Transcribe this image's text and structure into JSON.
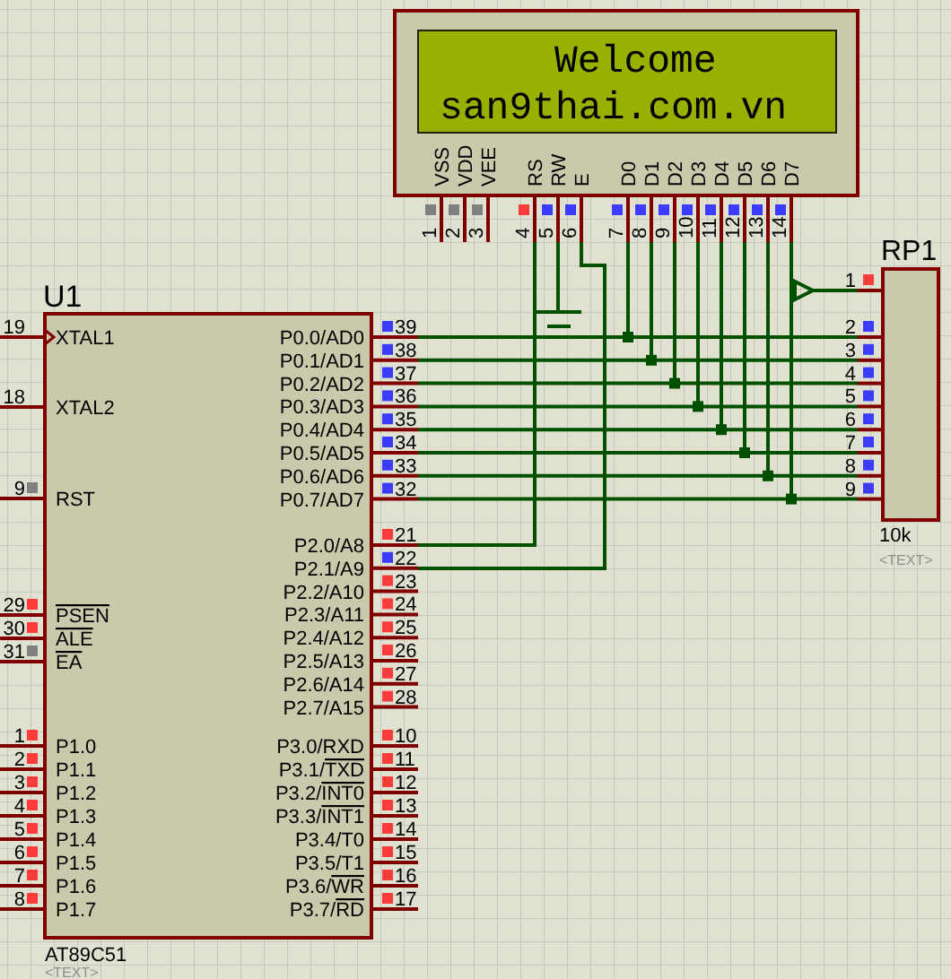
{
  "lcd": {
    "lines": [
      "Welcome",
      "san9thai.com.vn"
    ],
    "pins": [
      {
        "number": "1",
        "name": "VSS",
        "color": "#808080"
      },
      {
        "number": "2",
        "name": "VDD",
        "color": "#808080"
      },
      {
        "number": "3",
        "name": "VEE",
        "color": "#808080"
      },
      {
        "number": "4",
        "name": "RS",
        "color": "#ff3c3c"
      },
      {
        "number": "5",
        "name": "RW",
        "color": "#3c3cff"
      },
      {
        "number": "6",
        "name": "E",
        "color": "#3c3cff"
      },
      {
        "number": "7",
        "name": "D0",
        "color": "#3c3cff"
      },
      {
        "number": "8",
        "name": "D1",
        "color": "#3c3cff"
      },
      {
        "number": "9",
        "name": "D2",
        "color": "#3c3cff"
      },
      {
        "number": "10",
        "name": "D3",
        "color": "#3c3cff"
      },
      {
        "number": "11",
        "name": "D4",
        "color": "#3c3cff"
      },
      {
        "number": "12",
        "name": "D5",
        "color": "#3c3cff"
      },
      {
        "number": "13",
        "name": "D6",
        "color": "#3c3cff"
      },
      {
        "number": "14",
        "name": "D7",
        "color": "#3c3cff"
      }
    ]
  },
  "u1": {
    "reference": "U1",
    "part": "AT89C51",
    "text_label": "<TEXT>",
    "left_pins": [
      {
        "number": "19",
        "name": "XTAL1"
      },
      {
        "number": "18",
        "name": "XTAL2"
      },
      {
        "number": "9",
        "name": "RST",
        "color": "#808080"
      },
      {
        "number": "29",
        "name_barred": "PSEN",
        "color": "#ff3c3c"
      },
      {
        "number": "30",
        "name_barred": "ALE",
        "color": "#ff3c3c"
      },
      {
        "number": "31",
        "name_barred": "EA",
        "color": "#808080"
      },
      {
        "number": "1",
        "name": "P1.0",
        "color": "#ff3c3c"
      },
      {
        "number": "2",
        "name": "P1.1",
        "color": "#ff3c3c"
      },
      {
        "number": "3",
        "name": "P1.2",
        "color": "#ff3c3c"
      },
      {
        "number": "4",
        "name": "P1.3",
        "color": "#ff3c3c"
      },
      {
        "number": "5",
        "name": "P1.4",
        "color": "#ff3c3c"
      },
      {
        "number": "6",
        "name": "P1.5",
        "color": "#ff3c3c"
      },
      {
        "number": "7",
        "name": "P1.6",
        "color": "#ff3c3c"
      },
      {
        "number": "8",
        "name": "P1.7",
        "color": "#ff3c3c"
      }
    ],
    "right_pins": [
      {
        "number": "39",
        "name": "P0.0/AD0",
        "color": "#3c3cff"
      },
      {
        "number": "38",
        "name": "P0.1/AD1",
        "color": "#3c3cff"
      },
      {
        "number": "37",
        "name": "P0.2/AD2",
        "color": "#3c3cff"
      },
      {
        "number": "36",
        "name": "P0.3/AD3",
        "color": "#3c3cff"
      },
      {
        "number": "35",
        "name": "P0.4/AD4",
        "color": "#3c3cff"
      },
      {
        "number": "34",
        "name": "P0.5/AD5",
        "color": "#3c3cff"
      },
      {
        "number": "33",
        "name": "P0.6/AD6",
        "color": "#3c3cff"
      },
      {
        "number": "32",
        "name": "P0.7/AD7",
        "color": "#3c3cff"
      },
      {
        "number": "21",
        "name": "P2.0/A8",
        "color": "#ff3c3c"
      },
      {
        "number": "22",
        "name": "P2.1/A9",
        "color": "#3c3cff"
      },
      {
        "number": "23",
        "name": "P2.2/A10",
        "color": "#ff3c3c"
      },
      {
        "number": "24",
        "name": "P2.3/A11",
        "color": "#ff3c3c"
      },
      {
        "number": "25",
        "name": "P2.4/A12",
        "color": "#ff3c3c"
      },
      {
        "number": "26",
        "name": "P2.5/A13",
        "color": "#ff3c3c"
      },
      {
        "number": "27",
        "name": "P2.6/A14",
        "color": "#ff3c3c"
      },
      {
        "number": "28",
        "name": "P2.7/A15",
        "color": "#ff3c3c"
      },
      {
        "number": "10",
        "name": "P3.0/RXD",
        "color": "#ff3c3c"
      },
      {
        "number": "11",
        "name": "P3.1/",
        "name_barred": "TXD",
        "color": "#ff3c3c"
      },
      {
        "number": "12",
        "name": "P3.2/",
        "name_barred": "INT0",
        "color": "#ff3c3c"
      },
      {
        "number": "13",
        "name": "P3.3/",
        "name_barred": "INT1",
        "color": "#ff3c3c"
      },
      {
        "number": "14",
        "name": "P3.4/T0",
        "color": "#ff3c3c"
      },
      {
        "number": "15",
        "name": "P3.5/T1",
        "color": "#ff3c3c"
      },
      {
        "number": "16",
        "name": "P3.6/",
        "name_barred": "WR",
        "color": "#ff3c3c"
      },
      {
        "number": "17",
        "name": "P3.7/",
        "name_barred": "RD",
        "color": "#ff3c3c"
      }
    ]
  },
  "rp1": {
    "reference": "RP1",
    "value": "10k",
    "text_label": "<TEXT>",
    "pins": [
      {
        "number": "1",
        "color": "#ff3c3c"
      },
      {
        "number": "2",
        "color": "#3c3cff"
      },
      {
        "number": "3",
        "color": "#3c3cff"
      },
      {
        "number": "4",
        "color": "#3c3cff"
      },
      {
        "number": "5",
        "color": "#3c3cff"
      },
      {
        "number": "6",
        "color": "#3c3cff"
      },
      {
        "number": "7",
        "color": "#3c3cff"
      },
      {
        "number": "8",
        "color": "#3c3cff"
      },
      {
        "number": "9",
        "color": "#3c3cff"
      }
    ]
  }
}
